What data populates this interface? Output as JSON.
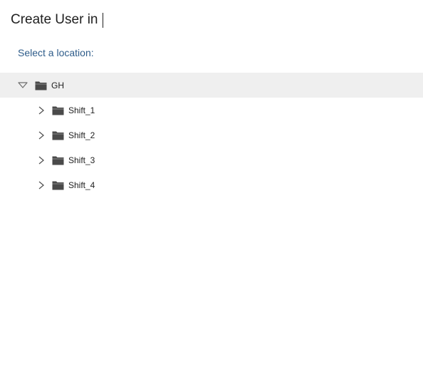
{
  "header": {
    "title": "Create User in"
  },
  "prompt": {
    "text": "Select a location:"
  },
  "tree": {
    "root": {
      "label": "GH",
      "expanded": true,
      "selected": true,
      "icon": "folder-icon",
      "toggle_icon": "triangle-down-icon"
    },
    "children": [
      {
        "label": "Shift_1",
        "expanded": false,
        "icon": "folder-icon",
        "toggle_icon": "chevron-right-icon"
      },
      {
        "label": "Shift_2",
        "expanded": false,
        "icon": "folder-icon",
        "toggle_icon": "chevron-right-icon"
      },
      {
        "label": "Shift_3",
        "expanded": false,
        "icon": "folder-icon",
        "toggle_icon": "chevron-right-icon"
      },
      {
        "label": "Shift_4",
        "expanded": false,
        "icon": "folder-icon",
        "toggle_icon": "chevron-right-icon"
      }
    ]
  },
  "colors": {
    "accent_text": "#2e5c8a",
    "selected_row_bg": "#efefef",
    "folder_fill": "#4a4a4a"
  }
}
